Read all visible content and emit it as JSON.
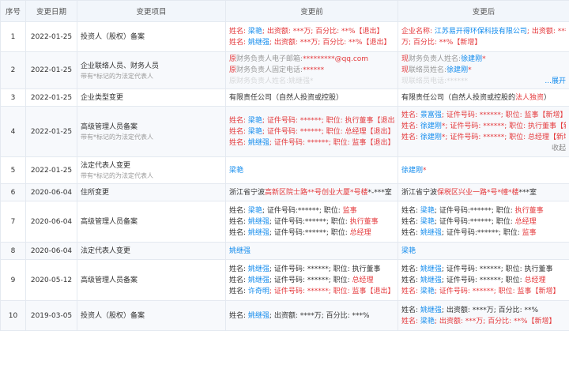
{
  "headers": [
    "序号",
    "变更日期",
    "变更项目",
    "变更前",
    "变更后"
  ],
  "rows": [
    {
      "no": "1",
      "date": "2022-01-25",
      "item": "投资人（股权）备案",
      "sub": "",
      "before": [
        [
          [
            "姓名: ",
            "r"
          ],
          [
            "梁艳",
            "b"
          ],
          [
            "; 出资额: ",
            "r"
          ],
          [
            "***万; 百分比: **%【退出】",
            "r"
          ]
        ],
        [
          [
            "姓名: ",
            "r"
          ],
          [
            "姚继强",
            "b"
          ],
          [
            "; 出资额: ***万; 百分比: **%【退出】",
            "r"
          ]
        ]
      ],
      "after": [
        [
          [
            "企业名称: ",
            "r"
          ],
          [
            "江苏易开得环保科技有限公司",
            "b"
          ],
          [
            "; 出资额: ***",
            "r"
          ]
        ],
        [
          [
            "万; 百分比: **%【新增】",
            "r"
          ]
        ]
      ]
    },
    {
      "no": "2",
      "date": "2022-01-25",
      "item": "企业联络人员、财务人员",
      "sub": "带有*标记的为法定代表人",
      "before": [
        [
          [
            "原",
            "r"
          ],
          [
            "财务负责人电子邮箱:",
            "g"
          ],
          [
            "*********@qq.com",
            "r"
          ]
        ],
        [
          [
            "原",
            "r"
          ],
          [
            "财务负责人固定电话:",
            "g"
          ],
          [
            "******",
            "r"
          ]
        ],
        [
          [
            "原财务负责人姓名:姚继强*",
            "g faded"
          ]
        ]
      ],
      "after": [
        [
          [
            "现",
            "r"
          ],
          [
            "财务负责人姓名:",
            "g"
          ],
          [
            "徐建刚",
            "b"
          ],
          [
            "*",
            "r"
          ]
        ],
        [
          [
            "现",
            "r"
          ],
          [
            "联络员姓名:",
            "g"
          ],
          [
            "徐建刚",
            "b"
          ],
          [
            "*",
            "r"
          ]
        ],
        [
          [
            "现联络员电话:******",
            "g faded"
          ]
        ]
      ]
    },
    {
      "no": "3",
      "date": "2022-01-25",
      "item": "企业类型变更",
      "sub": "",
      "before": [
        [
          [
            "有限责任公司（自然人投资或控股）",
            ""
          ]
        ]
      ],
      "after": [
        [
          [
            "有限责任公司（自然人投资或控股的",
            ""
          ],
          [
            "法人独资",
            "r"
          ],
          [
            "）",
            ""
          ]
        ]
      ]
    },
    {
      "no": "4",
      "date": "2022-01-25",
      "item": "高级管理人员备案",
      "sub": "带有*标记的为法定代表人",
      "before": [
        [
          [
            "姓名: ",
            "r"
          ],
          [
            "梁艳",
            "b"
          ],
          [
            "; 证件号码: ******; 职位: 执行董事【退出】",
            "r"
          ]
        ],
        [
          [
            "姓名: ",
            "r"
          ],
          [
            "梁艳",
            "b"
          ],
          [
            "; 证件号码: ******; 职位: 总经理【退出】",
            "r"
          ]
        ],
        [
          [
            "姓名: ",
            "r"
          ],
          [
            "姚继强",
            "b"
          ],
          [
            "; 证件号码: ******; 职位: 监事【退出】",
            "r"
          ]
        ]
      ],
      "after": [
        [
          [
            "姓名: ",
            "r"
          ],
          [
            "景富强",
            "b"
          ],
          [
            "; 证件号码: ******; 职位: 监事【新增】",
            "r"
          ]
        ],
        [
          [
            "姓名: ",
            "r"
          ],
          [
            "徐建刚",
            "b"
          ],
          [
            "*; 证件号码: ******; 职位: 执行董事【新增】",
            "r"
          ]
        ],
        [
          [
            "姓名: ",
            "r"
          ],
          [
            "徐建刚",
            "b"
          ],
          [
            "*; 证件号码: ******; 职位: 总经理【新增】",
            "r"
          ]
        ]
      ]
    },
    {
      "no": "5",
      "date": "2022-01-25",
      "item": "法定代表人变更",
      "sub": "带有*标记的为法定代表人",
      "before": [
        [
          [
            "梁艳",
            "b"
          ]
        ]
      ],
      "after": [
        [
          [
            "徐建刚",
            "b"
          ],
          [
            "*",
            "r"
          ]
        ]
      ]
    },
    {
      "no": "6",
      "date": "2020-06-04",
      "item": "住所变更",
      "sub": "",
      "before": [
        [
          [
            "浙江省宁波",
            ""
          ],
          [
            "高新区院士路**号创业大厦*号楼",
            "r"
          ],
          [
            "*-***室",
            ""
          ]
        ]
      ],
      "after": [
        [
          [
            "浙江省宁波",
            ""
          ],
          [
            "保税区兴业一路*号*幢*楼",
            "r"
          ],
          [
            "***室",
            ""
          ]
        ]
      ]
    },
    {
      "no": "7",
      "date": "2020-06-04",
      "item": "高级管理人员备案",
      "sub": "",
      "before": [
        [
          [
            "姓名: ",
            ""
          ],
          [
            "梁艳",
            "b"
          ],
          [
            "; 证件号码:******; 职位: ",
            ""
          ],
          [
            "监事",
            "r"
          ]
        ],
        [
          [
            "姓名: ",
            ""
          ],
          [
            "姚继强",
            "b"
          ],
          [
            "; 证件号码:******; 职位: ",
            ""
          ],
          [
            "执行董事",
            "r"
          ]
        ],
        [
          [
            "姓名: ",
            ""
          ],
          [
            "姚继强",
            "b"
          ],
          [
            "; 证件号码:******; 职位: ",
            ""
          ],
          [
            "总经理",
            "r"
          ]
        ]
      ],
      "after": [
        [
          [
            "姓名: ",
            ""
          ],
          [
            "梁艳",
            "b"
          ],
          [
            "; 证件号码:******; 职位: ",
            ""
          ],
          [
            "执行董事",
            "r"
          ]
        ],
        [
          [
            "姓名: ",
            ""
          ],
          [
            "梁艳",
            "b"
          ],
          [
            "; 证件号码:******; 职位: ",
            ""
          ],
          [
            "总经理",
            "r"
          ]
        ],
        [
          [
            "姓名: ",
            ""
          ],
          [
            "姚继强",
            "b"
          ],
          [
            "; 证件号码:******; 职位: ",
            ""
          ],
          [
            "监事",
            "r"
          ]
        ]
      ]
    },
    {
      "no": "8",
      "date": "2020-06-04",
      "item": "法定代表人变更",
      "sub": "",
      "before": [
        [
          [
            "姚继强",
            "b"
          ]
        ]
      ],
      "after": [
        [
          [
            "梁艳",
            "b"
          ]
        ]
      ]
    },
    {
      "no": "9",
      "date": "2020-05-12",
      "item": "高级管理人员备案",
      "sub": "",
      "before": [
        [
          [
            "姓名: ",
            ""
          ],
          [
            "姚继强",
            "b"
          ],
          [
            "; 证件号码: ******; 职位: 执行董事",
            ""
          ]
        ],
        [
          [
            "姓名: ",
            ""
          ],
          [
            "姚继强",
            "b"
          ],
          [
            "; 证件号码: ******; 职位: ",
            ""
          ],
          [
            "总经理",
            "r"
          ]
        ],
        [
          [
            "姓名: ",
            ""
          ],
          [
            "许奇明",
            "b"
          ],
          [
            "; 证件号码: ******; 职位: 监事【退出】",
            "r"
          ]
        ]
      ],
      "after": [
        [
          [
            "姓名: ",
            ""
          ],
          [
            "姚继强",
            "b"
          ],
          [
            "; 证件号码: ******; 职位: 执行董事",
            ""
          ]
        ],
        [
          [
            "姓名: ",
            ""
          ],
          [
            "姚继强",
            "b"
          ],
          [
            "; 证件号码: ******; 职位: ",
            ""
          ],
          [
            "总经理",
            "r"
          ]
        ],
        [
          [
            "姓名: ",
            "r"
          ],
          [
            "梁艳",
            "b"
          ],
          [
            "; 证件号码: ******; 职位: 监事【新增】",
            "r"
          ]
        ]
      ]
    },
    {
      "no": "10",
      "date": "2019-03-05",
      "item": "投资人（股权）备案",
      "sub": "",
      "before": [
        [
          [
            "姓名: ",
            ""
          ],
          [
            "姚继强",
            "b"
          ],
          [
            "; 出资额: ****万; 百分比: ***%",
            ""
          ]
        ]
      ],
      "after": [
        [
          [
            "姓名: ",
            ""
          ],
          [
            "姚继强",
            "b"
          ],
          [
            "; 出资额: ****万; 百分比: **%",
            ""
          ]
        ],
        [
          [
            "姓名: ",
            "r"
          ],
          [
            "梁艳",
            "b"
          ],
          [
            "; 出资额: ***万; 百分比: **%【新增】",
            "r"
          ]
        ]
      ]
    }
  ],
  "expand_label": "...展开",
  "collapse_label": "收起"
}
